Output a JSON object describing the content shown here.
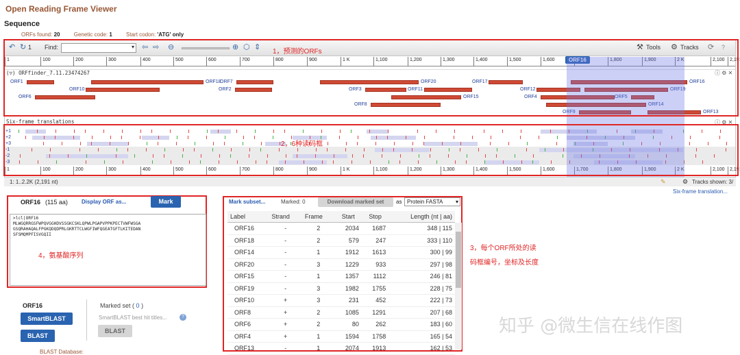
{
  "header": {
    "title": "Open Reading Frame Viewer",
    "section": "Sequence",
    "orfs_found_label": "ORFs found:",
    "orfs_found": "20",
    "genetic_code_label": "Genetic code:",
    "genetic_code": "1",
    "start_codon_label": "Start codon:",
    "start_codon": "'ATG' only"
  },
  "toolbar": {
    "undo_icon": "undo-icon",
    "history": "1",
    "find_label": "Find:",
    "tools": "Tools",
    "tracks": "Tracks",
    "refresh_icon": "refresh-icon",
    "help": "?"
  },
  "ruler": {
    "ticks": [
      "1",
      "100",
      "200",
      "300",
      "400",
      "500",
      "600",
      "700",
      "800",
      "900",
      "1 K",
      "1,100",
      "1,200",
      "1,300",
      "1,400",
      "1,500",
      "1,600",
      "1,700",
      "1,800",
      "1,900",
      "2 K",
      "2,100",
      "2,191"
    ],
    "marker": "ORF16"
  },
  "orf_track": {
    "title": "ORFfinder_7.11.23474267",
    "orfs": [
      {
        "label": "ORF1",
        "row": 0,
        "lbl": "left"
      },
      {
        "label": "ORF18",
        "row": 0,
        "lbl": "right"
      },
      {
        "label": "ORF7",
        "row": 0,
        "lbl": "left"
      },
      {
        "label": "ORF20",
        "row": 0,
        "lbl": "right"
      },
      {
        "label": "ORF17",
        "row": 0,
        "lbl": "left"
      },
      {
        "label": "ORF16",
        "row": 0,
        "lbl": "right"
      },
      {
        "label": "ORF10",
        "row": 1,
        "lbl": "left"
      },
      {
        "label": "ORF2",
        "row": 1,
        "lbl": "left"
      },
      {
        "label": "ORF3",
        "row": 1,
        "lbl": "left"
      },
      {
        "label": "ORF11",
        "row": 1,
        "lbl": "left"
      },
      {
        "label": "ORF12",
        "row": 1,
        "lbl": "left"
      },
      {
        "label": "ORF19",
        "row": 1,
        "lbl": "right"
      },
      {
        "label": "ORF6",
        "row": 2,
        "lbl": "left"
      },
      {
        "label": "ORF15",
        "row": 2,
        "lbl": "right"
      },
      {
        "label": "ORF4",
        "row": 2,
        "lbl": "left"
      },
      {
        "label": "ORF5",
        "row": 2,
        "lbl": "left"
      },
      {
        "label": "ORF8",
        "row": 3,
        "lbl": "left"
      },
      {
        "label": "ORF14",
        "row": 3,
        "lbl": "right"
      },
      {
        "label": "ORF9",
        "row": 4,
        "lbl": "left"
      },
      {
        "label": "ORF13",
        "row": 4,
        "lbl": "right"
      }
    ]
  },
  "six_frame": {
    "title": "Six-frame translations",
    "frames": [
      "+1",
      "+2",
      "+3",
      "-1",
      "-2",
      "-3"
    ]
  },
  "status": {
    "range": "1: 1..2.2K (2,191 nt)",
    "tracks_shown": "Tracks shown: 3/"
  },
  "six_frame_link": "Six-frame translation...",
  "annotations": {
    "a1": "1，预测的ORFs",
    "a2": "2，6种读码框",
    "a3_line1": "3，每个ORF所处的读",
    "a3_line2": "码框编号，坐标及长度",
    "a4": "4，氨基酸序列"
  },
  "orf_panel": {
    "name": "ORF16",
    "aa": "(115 aa)",
    "display": "Display ORF as...",
    "mark": "Mark",
    "sequence": ">lcl|ORF16\nMLWGQRRGSFWPQVGGHDVSSGKCSKLQPWLPGAPVPPKPECTVWFWSGA\nGSQRAHAQALFPGKQDQDPRLGKRTTCLWGFIWFQGEATGFTLKITEDAN\nSFSMQMPFISVGQII"
  },
  "table": {
    "mark_subset": "Mark subset...",
    "marked": "Marked: 0",
    "download": "Download marked set",
    "as": "as",
    "format": "Protein FASTA",
    "headers": [
      "Label",
      "Strand",
      "Frame",
      "Start",
      "Stop",
      "Length (nt | aa)"
    ],
    "rows": [
      [
        "ORF16",
        "-",
        "2",
        "2034",
        "1687",
        "348 | 115"
      ],
      [
        "ORF18",
        "-",
        "2",
        "579",
        "247",
        "333 | 110"
      ],
      [
        "ORF14",
        "-",
        "1",
        "1912",
        "1613",
        "300 | 99"
      ],
      [
        "ORF20",
        "-",
        "3",
        "1229",
        "933",
        "297 | 98"
      ],
      [
        "ORF15",
        "-",
        "1",
        "1357",
        "1112",
        "246 | 81"
      ],
      [
        "ORF19",
        "-",
        "3",
        "1982",
        "1755",
        "228 | 75"
      ],
      [
        "ORF10",
        "+",
        "3",
        "231",
        "452",
        "222 | 73"
      ],
      [
        "ORF8",
        "+",
        "2",
        "1085",
        "1291",
        "207 | 68"
      ],
      [
        "ORF6",
        "+",
        "2",
        "80",
        "262",
        "183 | 60"
      ],
      [
        "ORF4",
        "+",
        "1",
        "1594",
        "1758",
        "165 | 54"
      ],
      [
        "ORF13",
        "-",
        "1",
        "2074",
        "1913",
        "162 | 53"
      ]
    ]
  },
  "blast": {
    "orf": "ORF16",
    "smartblast": "SmartBLAST",
    "blast": "BLAST",
    "marked_set": "Marked set (",
    "marked_count": "0",
    "marked_close": ")",
    "best_hit": "SmartBLAST best hit titles...",
    "blast_gray": "BLAST",
    "database": "BLAST Database:"
  },
  "watermark": "知乎 @微生信在线作图",
  "colors": {
    "orf": "#cf4a35",
    "label_blue": "#22409a",
    "annotation_red": "#e02424",
    "button_blue": "#2a63b0"
  }
}
